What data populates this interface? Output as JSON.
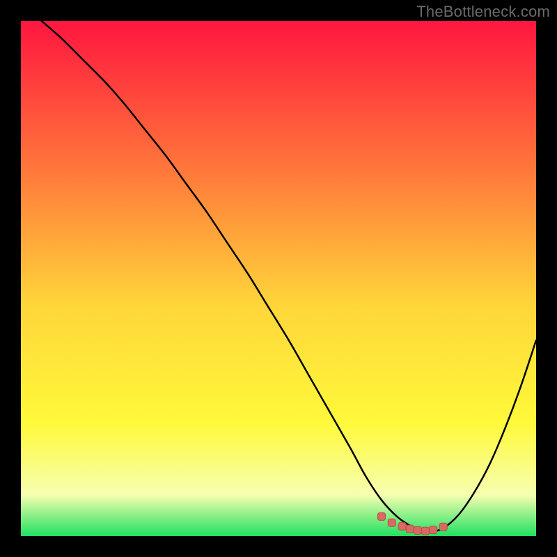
{
  "watermark": "TheBottleneck.com",
  "colors": {
    "page_bg": "#000000",
    "watermark": "#6a6a6a",
    "curve": "#000000",
    "marker_fill": "#d96a63",
    "marker_stroke": "#b94a45",
    "gradient_top": "#ff163f",
    "gradient_mid1": "#ff7b3a",
    "gradient_mid2": "#ffd53a",
    "gradient_mid3": "#fff93a",
    "gradient_mid4": "#f6ffb0",
    "gradient_bottom": "#20e060"
  },
  "chart_data": {
    "type": "line",
    "title": "",
    "xlabel": "",
    "ylabel": "",
    "xlim": [
      0,
      100
    ],
    "ylim": [
      0,
      100
    ],
    "grid": false,
    "legend": false,
    "series": [
      {
        "name": "bottleneck-curve",
        "x": [
          4,
          8,
          12,
          16,
          20,
          24,
          28,
          32,
          36,
          40,
          44,
          48,
          52,
          56,
          60,
          64,
          67,
          70,
          73,
          76,
          79,
          82,
          85,
          88,
          91,
          94,
          97,
          100
        ],
        "y": [
          100,
          96.5,
          92.5,
          88.5,
          84,
          79,
          74,
          68.5,
          63,
          57,
          51,
          44.5,
          38,
          31,
          24,
          17,
          11.5,
          7,
          3.8,
          1.8,
          0.8,
          1.6,
          4.2,
          8.5,
          14,
          21,
          29,
          38
        ]
      }
    ],
    "markers": {
      "name": "flat-bottom-markers",
      "x": [
        70,
        72,
        74,
        75.5,
        77,
        78.5,
        80,
        82
      ],
      "y": [
        3.8,
        2.6,
        1.9,
        1.4,
        1.1,
        1.0,
        1.2,
        1.8
      ]
    }
  }
}
